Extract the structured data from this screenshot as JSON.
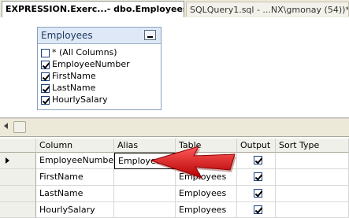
{
  "tabs": [
    {
      "label": "EXPRESSION.Exerc...- dbo.Employees*",
      "active": true
    },
    {
      "label": "SQLQuery1.sql - ...NX\\gmonay (54))*",
      "active": false
    }
  ],
  "diagram": {
    "table_title": "Employees",
    "columns": [
      {
        "label": "* (All Columns)",
        "checked": false
      },
      {
        "label": "EmployeeNumber",
        "checked": true
      },
      {
        "label": "FirstName",
        "checked": true
      },
      {
        "label": "LastName",
        "checked": true
      },
      {
        "label": "HourlySalary",
        "checked": true
      }
    ]
  },
  "grid": {
    "headers": {
      "column": "Column",
      "alias": "Alias",
      "table": "Table",
      "output": "Output",
      "sort_type": "Sort Type"
    },
    "rows": [
      {
        "column": "EmployeeNumber",
        "alias": "Employee #",
        "table": "Employees",
        "output": true
      },
      {
        "column": "FirstName",
        "alias": "",
        "table": "Employees",
        "output": true
      },
      {
        "column": "LastName",
        "alias": "",
        "table": "Employees",
        "output": true
      },
      {
        "column": "HourlySalary",
        "alias": "",
        "table": "Employees",
        "output": true
      }
    ]
  },
  "colors": {
    "annotation_arrow": "#e01010",
    "panel_bg": "#ece9d8"
  },
  "icons": {
    "row_marker": "row-selector-triangle",
    "annotation": "red-pointer-arrow"
  }
}
